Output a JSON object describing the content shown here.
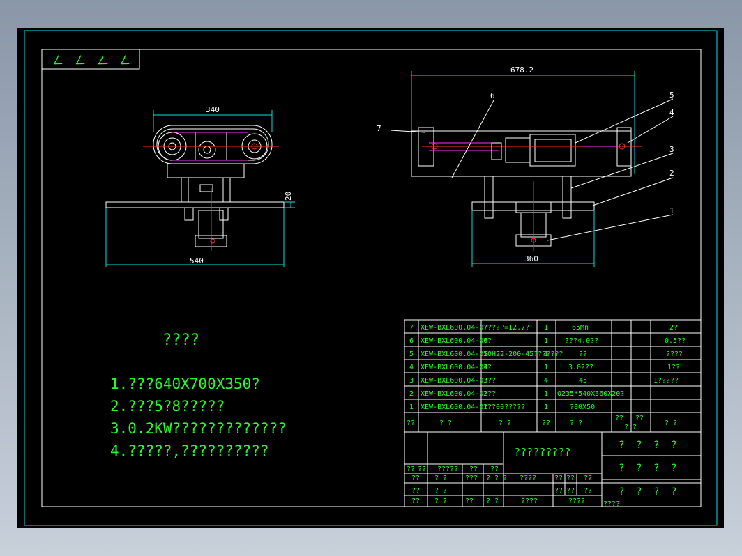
{
  "drawing": {
    "corner_marks": [
      "ㄥ",
      "ㄥ",
      "ㄥ",
      "ㄥ"
    ],
    "dimensions": {
      "front_top": "340",
      "front_height": "20",
      "front_bottom": "540",
      "side_top": "678.2",
      "side_bottom": "360"
    },
    "balloons": [
      "7",
      "6",
      "5",
      "4",
      "3",
      "2",
      "1"
    ],
    "notes": {
      "title": "????",
      "line1": "1.???640X700X350?",
      "line2": "2.???5?8?????",
      "line3": "3.0.2KW?????????????",
      "line4": "4.?????,??????????"
    }
  },
  "bom": {
    "rows": [
      {
        "no": "7",
        "code": "XEW-BXL600.04-07",
        "name": "????P=12.7?",
        "qty": "1",
        "material": "65Mn",
        "note": "2?"
      },
      {
        "no": "6",
        "code": "XEW-BXL600.04-06",
        "name": "??",
        "qty": "1",
        "material": "???4.0??",
        "note": "0.5??"
      },
      {
        "no": "5",
        "code": "XEW-BXL600.04-05",
        "name": "1ОН22-200-45???????",
        "qty": "1",
        "material": "??",
        "note": "????"
      },
      {
        "no": "4",
        "code": "XEW-BXL600.04-04",
        "name": "??",
        "qty": "1",
        "material": "3.0???",
        "note": "1??"
      },
      {
        "no": "3",
        "code": "XEW-BXL600.04-03",
        "name": "???",
        "qty": "4",
        "material": "45",
        "note": "1?????"
      },
      {
        "no": "2",
        "code": "XEW-BXL600.04-02",
        "name": "???",
        "qty": "1",
        "material": "Q235*540X360X20?",
        "note": ""
      },
      {
        "no": "1",
        "code": "XEW-BXL600.04-01",
        "name": "???00?????",
        "qty": "1",
        "material": "?80X50",
        "note": ""
      }
    ],
    "header": {
      "no": "??",
      "code": "?  ?",
      "name": "?  ?",
      "qty": "??",
      "material": "?  ?",
      "w1": "??",
      "w2": "??",
      "wsub": "?  ?",
      "note": "?  ?"
    }
  },
  "titleblock": {
    "center_title": "?????????",
    "right_cells": [
      "?",
      "?",
      "?",
      "?",
      "?",
      "?",
      "?",
      "?",
      "?",
      "?",
      "?",
      "?"
    ],
    "small_labels": [
      "??",
      "??",
      "?????",
      "??",
      "??",
      "??",
      "? ?",
      "???",
      "? ? ?",
      "????",
      "??",
      "??",
      "??",
      "??",
      "? ?",
      "??",
      "??",
      "??",
      "??",
      "? ?",
      "??",
      "? ?",
      "????",
      "????",
      "????"
    ]
  },
  "colors": {
    "background": "#000000",
    "frame": "#ffffff",
    "dimension": "#00e0e0",
    "annotation": "#22ff22",
    "detail": "#ff33ff",
    "centerline": "#ff3030"
  }
}
